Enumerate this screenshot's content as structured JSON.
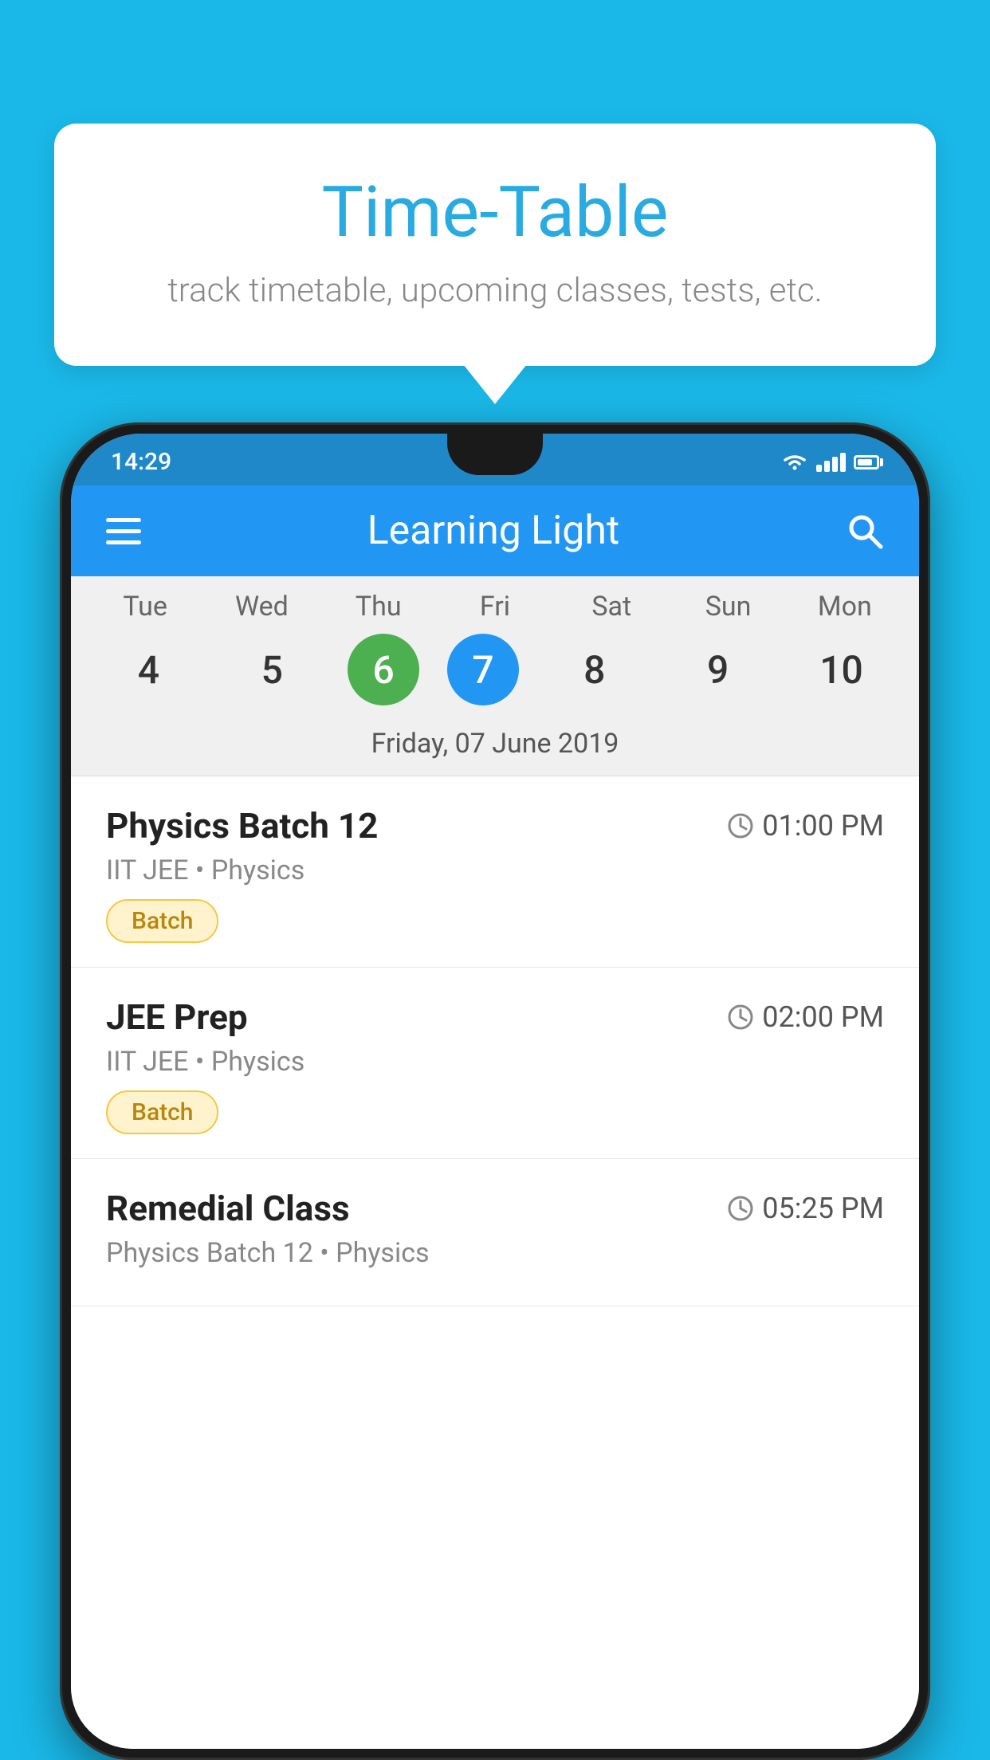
{
  "background_color": "#1ab8e8",
  "tooltip": {
    "title": "Time-Table",
    "subtitle": "track timetable, upcoming classes, tests, etc."
  },
  "phone": {
    "status_bar": {
      "time": "14:29"
    },
    "app_bar": {
      "title": "Learning Light",
      "menu_icon": "hamburger-icon",
      "search_icon": "search-icon"
    },
    "calendar": {
      "days": [
        "Tue",
        "Wed",
        "Thu",
        "Fri",
        "Sat",
        "Sun",
        "Mon"
      ],
      "dates": [
        "4",
        "5",
        "6",
        "7",
        "8",
        "9",
        "10"
      ],
      "today_index": 2,
      "selected_index": 3,
      "selected_date_label": "Friday, 07 June 2019"
    },
    "schedule": [
      {
        "title": "Physics Batch 12",
        "time": "01:00 PM",
        "subtitle": "IIT JEE • Physics",
        "tag": "Batch"
      },
      {
        "title": "JEE Prep",
        "time": "02:00 PM",
        "subtitle": "IIT JEE • Physics",
        "tag": "Batch"
      },
      {
        "title": "Remedial Class",
        "time": "05:25 PM",
        "subtitle": "Physics Batch 12 • Physics",
        "tag": ""
      }
    ]
  }
}
